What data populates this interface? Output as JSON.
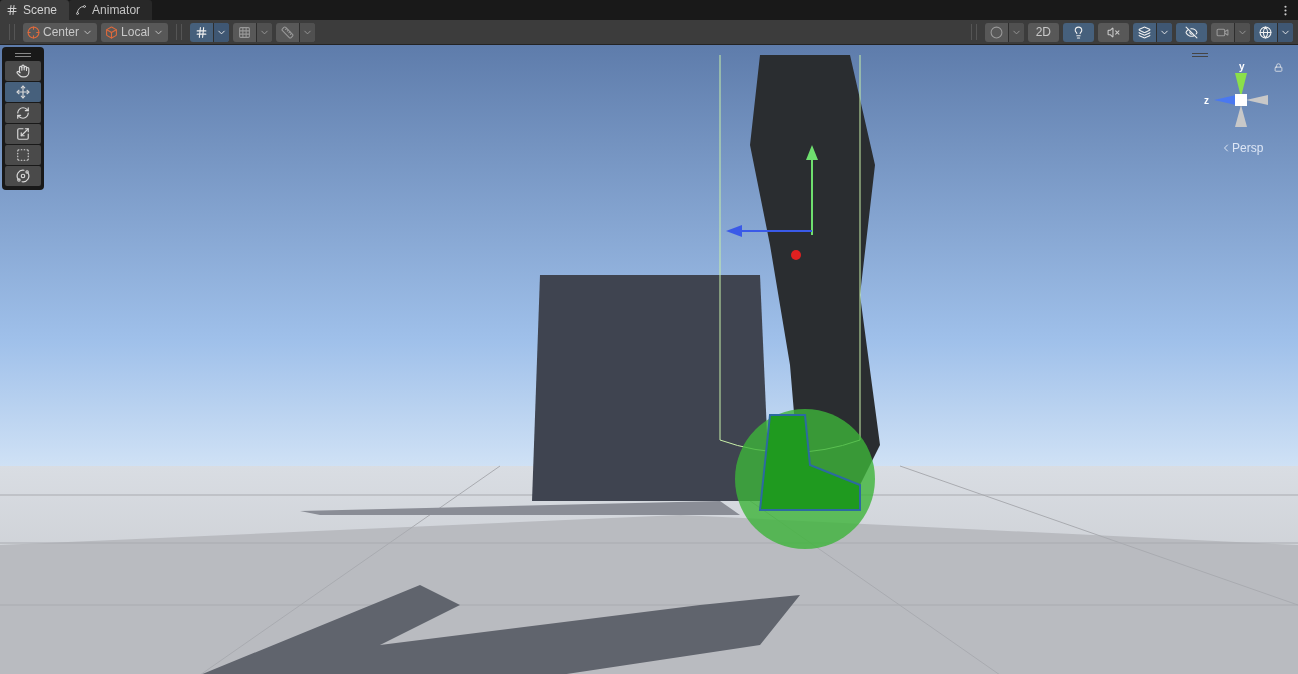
{
  "tabs": [
    {
      "label": "Scene",
      "selected": true
    },
    {
      "label": "Animator",
      "selected": false
    }
  ],
  "toolbar_left": [
    {
      "kind": "dropdown",
      "label": "Center"
    },
    {
      "kind": "dropdown",
      "label": "Local"
    },
    {
      "kind": "split",
      "on": true
    },
    {
      "kind": "split",
      "on": false
    },
    {
      "kind": "split",
      "on": false
    }
  ],
  "toolbar_right": [
    {
      "kind": "split",
      "on": false
    },
    {
      "kind": "toggle",
      "label": "2D",
      "on": false
    },
    {
      "kind": "toggle",
      "on": true
    },
    {
      "kind": "toggle",
      "on": false
    },
    {
      "kind": "split",
      "on": true
    },
    {
      "kind": "toggle",
      "on": true
    },
    {
      "kind": "split",
      "on": false
    },
    {
      "kind": "split",
      "on": true
    }
  ],
  "tools": [
    {
      "selected": false
    },
    {
      "selected": true
    },
    {
      "selected": false
    },
    {
      "selected": false
    },
    {
      "selected": false
    },
    {
      "selected": false
    }
  ],
  "gizmo": {
    "y_label": "y",
    "z_label": "z",
    "projection": "Persp"
  }
}
